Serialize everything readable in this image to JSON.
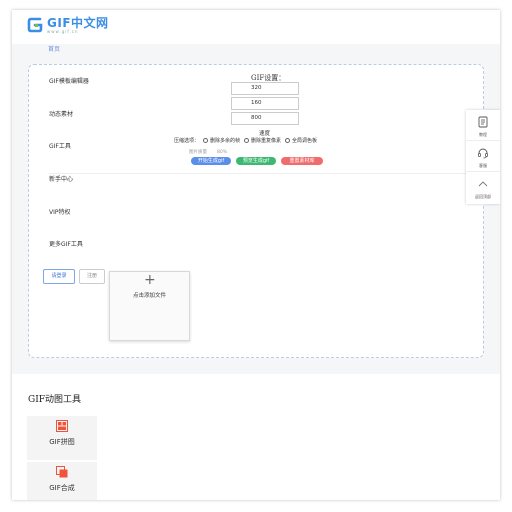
{
  "header": {
    "logo_title": "GIF中文网",
    "logo_sub": "www.gif.cn"
  },
  "breadcrumb": "首页",
  "sidebar": {
    "items": [
      {
        "label": "GIF模板编辑器"
      },
      {
        "label": "动态素材"
      },
      {
        "label": "GIF工具"
      },
      {
        "label": "新手中心"
      },
      {
        "label": "VIP特权"
      },
      {
        "label": "更多GIF工具"
      }
    ]
  },
  "settings": {
    "title": "GIF设置：",
    "inputs": [
      "320",
      "160",
      "800"
    ],
    "speed_label": "速度",
    "compress_label": "压缩选项：",
    "compress_options": [
      "删除多余的帧",
      "删除重复像素",
      "全局调色板"
    ],
    "quality_label": "图片质量",
    "quality_value": "80%",
    "buttons": {
      "start": "开始生成gif",
      "preview": "预览生成gif",
      "reset": "重置素材库"
    }
  },
  "auth": {
    "login": "请登录",
    "register": "注册"
  },
  "upload": {
    "plus": "+",
    "label": "点击添加文件"
  },
  "floatbar": {
    "items": [
      {
        "label": "教程",
        "icon": "document-icon"
      },
      {
        "label": "客服",
        "icon": "headset-icon"
      },
      {
        "label": "返回顶部",
        "icon": "chevron-up-icon"
      }
    ]
  },
  "tools": {
    "title": "GIF动图工具",
    "items": [
      {
        "label": "GIF拼图",
        "icon": "puzzle-grid-icon"
      },
      {
        "label": "GIF合成",
        "icon": "merge-layers-icon"
      }
    ]
  },
  "colors": {
    "accent": "#3a8ee6",
    "start_button": "#5b8dea",
    "preview_button": "#3cb873",
    "reset_button": "#f06b6b",
    "tool_icon": "#f0533c"
  }
}
